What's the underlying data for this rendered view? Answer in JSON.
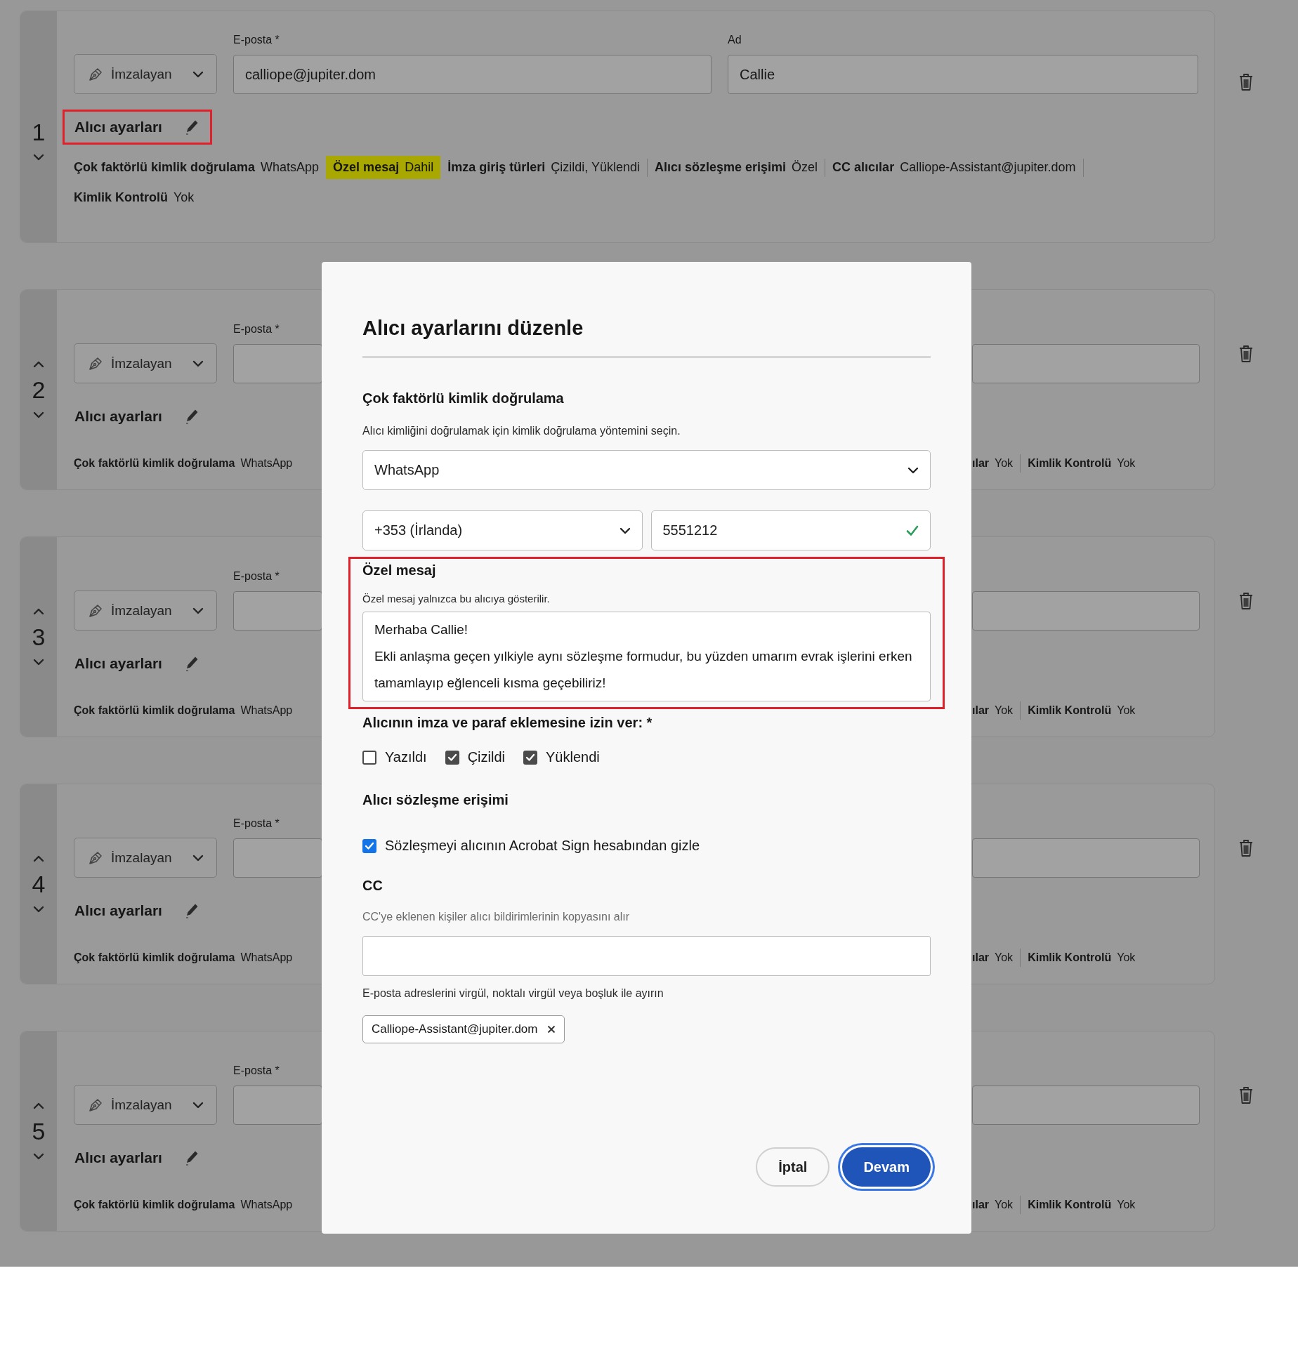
{
  "recipients": [
    {
      "number": "1",
      "can_move_up": false,
      "can_move_down": true,
      "role": "İmzalayan",
      "email_label": "E-posta *",
      "email": "calliope@jupiter.dom",
      "name_label": "Ad",
      "name": "Callie",
      "settings_label": "Alıcı ayarları",
      "settings_highlighted": true,
      "summary": [
        {
          "label": "Çok faktörlü kimlik doğrulama",
          "value": "WhatsApp",
          "highlighted": false
        },
        {
          "label": "Özel mesaj",
          "value": "Dahil",
          "highlighted": true
        },
        {
          "label": "İmza giriş türleri",
          "value": "Çizildi, Yüklendi",
          "highlighted": false
        },
        {
          "label": "Alıcı sözleşme erişimi",
          "value": "Özel",
          "highlighted": false
        },
        {
          "label": "CC alıcılar",
          "value": "Calliope-Assistant@jupiter.dom",
          "highlighted": false
        },
        {
          "label": "Kimlik Kontrolü",
          "value": "Yok",
          "highlighted": false
        }
      ]
    },
    {
      "number": "2",
      "can_move_up": true,
      "can_move_down": true,
      "role": "İmzalayan",
      "email_label": "E-posta *",
      "settings_label": "Alıcı ayarları",
      "settings_highlighted": false,
      "summary_left": [
        {
          "label": "Çok faktörlü kimlik doğrulama",
          "value": "WhatsApp"
        }
      ],
      "summary_right": [
        {
          "label": "ılar",
          "value": "Yok"
        },
        {
          "label": "Kimlik Kontrolü",
          "value": "Yok"
        }
      ]
    },
    {
      "number": "3",
      "can_move_up": true,
      "can_move_down": true,
      "role": "İmzalayan",
      "email_label": "E-posta *",
      "settings_label": "Alıcı ayarları",
      "settings_highlighted": false,
      "summary_left": [
        {
          "label": "Çok faktörlü kimlik doğrulama",
          "value": "WhatsApp"
        }
      ],
      "summary_right": [
        {
          "label": "ılar",
          "value": "Yok"
        },
        {
          "label": "Kimlik Kontrolü",
          "value": "Yok"
        }
      ]
    },
    {
      "number": "4",
      "can_move_up": true,
      "can_move_down": true,
      "role": "İmzalayan",
      "email_label": "E-posta *",
      "settings_label": "Alıcı ayarları",
      "settings_highlighted": false,
      "summary_left": [
        {
          "label": "Çok faktörlü kimlik doğrulama",
          "value": "WhatsApp"
        }
      ],
      "summary_right": [
        {
          "label": "ılar",
          "value": "Yok"
        },
        {
          "label": "Kimlik Kontrolü",
          "value": "Yok"
        }
      ]
    },
    {
      "number": "5",
      "can_move_up": true,
      "can_move_down": true,
      "role": "İmzalayan",
      "email_label": "E-posta *",
      "settings_label": "Alıcı ayarları",
      "settings_highlighted": false,
      "summary_left": [
        {
          "label": "Çok faktörlü kimlik doğrulama",
          "value": "WhatsApp"
        }
      ],
      "summary_right": [
        {
          "label": "ılar",
          "value": "Yok"
        },
        {
          "label": "Kimlik Kontrolü",
          "value": "Yok"
        }
      ]
    }
  ],
  "dialog": {
    "title": "Alıcı ayarlarını düzenle",
    "mfa": {
      "heading": "Çok faktörlü kimlik doğrulama",
      "description": "Alıcı kimliğini doğrulamak için kimlik doğrulama yöntemini seçin.",
      "method": "WhatsApp",
      "country": "+353 (İrlanda)",
      "phone": "5551212",
      "phone_valid": true
    },
    "message": {
      "heading": "Özel mesaj",
      "description": "Özel mesaj yalnızca bu alıcıya gösterilir.",
      "text": "Merhaba Callie!\nEkli anlaşma geçen yılkiyle aynı sözleşme formudur, bu yüzden umarım evrak işlerini erken tamamlayıp eğlenceli kısma geçebiliriz!",
      "highlighted": true
    },
    "signature_types": {
      "heading": "Alıcının imza ve paraf eklemesine izin ver: *",
      "options": [
        {
          "label": "Yazıldı",
          "checked": false
        },
        {
          "label": "Çizildi",
          "checked": true
        },
        {
          "label": "Yüklendi",
          "checked": true
        }
      ]
    },
    "access": {
      "heading": "Alıcı sözleşme erişimi",
      "options": [
        {
          "label": "Sözleşmeyi alıcının Acrobat Sign hesabından gizle",
          "checked": true
        }
      ]
    },
    "cc": {
      "heading": "CC",
      "description": "CC'ye eklenen kişiler alıcı bildirimlerinin kopyasını alır",
      "hint": "E-posta adreslerini virgül, noktalı virgül veya boşluk ile ayırın",
      "chips": [
        "Calliope-Assistant@jupiter.dom"
      ]
    },
    "buttons": [
      {
        "label": "İptal",
        "kind": "secondary",
        "focused": false
      },
      {
        "label": "Devam",
        "kind": "primary",
        "focused": true
      }
    ]
  }
}
